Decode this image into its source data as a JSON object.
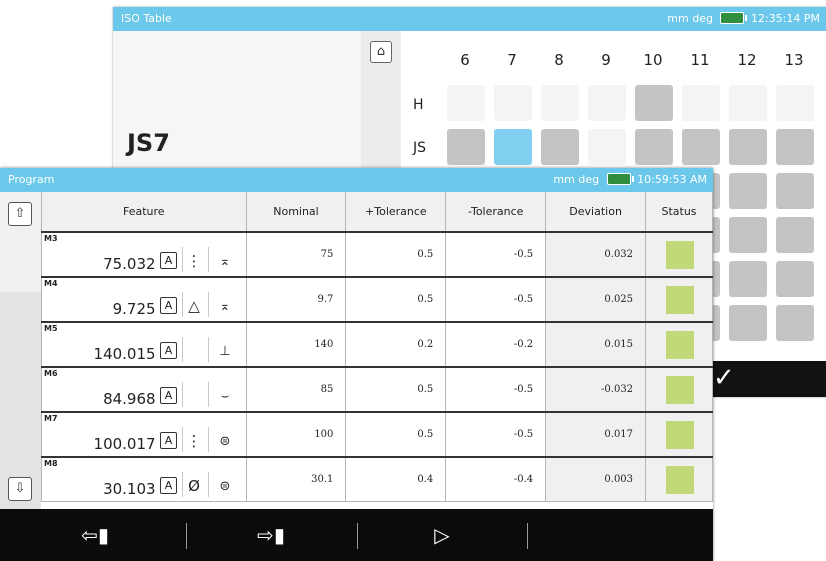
{
  "iso_window": {
    "title": "ISO Table",
    "status_right": "mm  deg",
    "clock": "12:35:14 PM",
    "fit_label": "JS7",
    "up_icon": "home-up-icon",
    "columns": [
      "6",
      "7",
      "8",
      "9",
      "10",
      "11",
      "12",
      "13"
    ],
    "rows": [
      "H",
      "JS"
    ],
    "confirm_icon": "check-icon",
    "colors": {
      "selected": "#80cef0",
      "gray": "#c4c4c4",
      "light": "#f4f4f4"
    }
  },
  "program_window": {
    "title": "Program",
    "status_right": "mm  deg",
    "clock": "10:59:53 AM",
    "headers": {
      "feature": "Feature",
      "nominal": "Nominal",
      "plus_tol": "+Tolerance",
      "minus_tol": "-Tolerance",
      "deviation": "Deviation",
      "status": "Status"
    },
    "rows": [
      {
        "id": "M3",
        "value": "75.032",
        "badge": "A",
        "symbol": "⋮",
        "datum": "⌅",
        "nominal": "75",
        "plus": "0.5",
        "minus": "-0.5",
        "deviation": "0.032"
      },
      {
        "id": "M4",
        "value": "9.725",
        "badge": "A",
        "symbol": "△",
        "datum": "⌅",
        "nominal": "9.7",
        "plus": "0.5",
        "minus": "-0.5",
        "deviation": "0.025"
      },
      {
        "id": "M5",
        "value": "140.015",
        "badge": "A",
        "symbol": "",
        "datum": "⊥",
        "nominal": "140",
        "plus": "0.2",
        "minus": "-0.2",
        "deviation": "0.015"
      },
      {
        "id": "M6",
        "value": "84.968",
        "badge": "A",
        "symbol": "",
        "datum": "⌣",
        "nominal": "85",
        "plus": "0.5",
        "minus": "-0.5",
        "deviation": "-0.032"
      },
      {
        "id": "M7",
        "value": "100.017",
        "badge": "A",
        "symbol": "⋮",
        "datum": "⊜",
        "nominal": "100",
        "plus": "0.5",
        "minus": "-0.5",
        "deviation": "0.017"
      },
      {
        "id": "M8",
        "value": "30.103",
        "badge": "A",
        "symbol": "Ø",
        "datum": "⊜",
        "nominal": "30.1",
        "plus": "0.4",
        "minus": "-0.4",
        "deviation": "0.003"
      }
    ],
    "status_color": "#c2d97a",
    "toolbar": {
      "export_icon": "usb-export-icon",
      "import_icon": "usb-import-icon",
      "run_icon": "play-icon"
    }
  }
}
